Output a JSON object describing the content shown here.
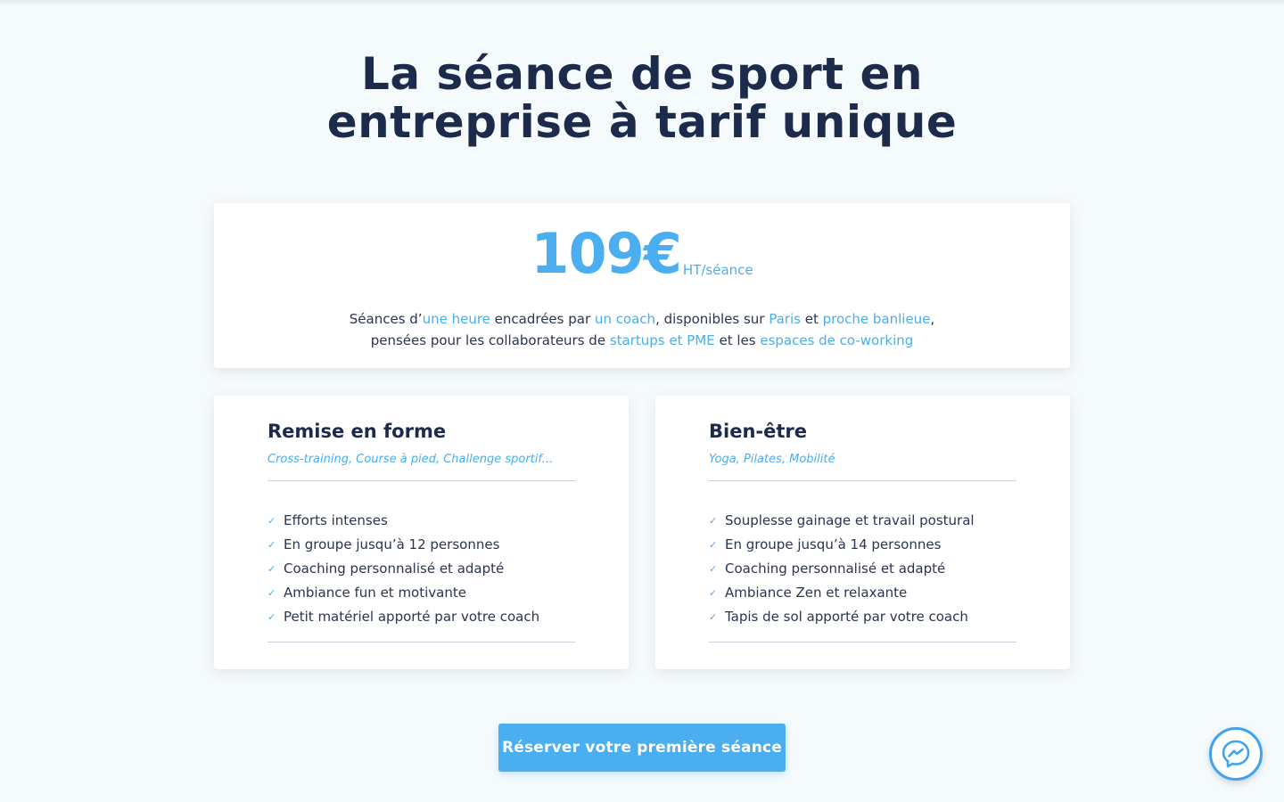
{
  "hero": {
    "title_line1": "La séance de sport en",
    "title_line2": "entreprise à tarif unique"
  },
  "pricing": {
    "amount": "109€",
    "unit": "HT/séance",
    "desc_line1": [
      {
        "text": "Séances d’",
        "hl": false
      },
      {
        "text": "une heure",
        "hl": true
      },
      {
        "text": " encadrées par ",
        "hl": false
      },
      {
        "text": "un coach",
        "hl": true
      },
      {
        "text": ", disponibles sur ",
        "hl": false
      },
      {
        "text": "Paris",
        "hl": true
      },
      {
        "text": " et ",
        "hl": false
      },
      {
        "text": "proche banlieue",
        "hl": true
      },
      {
        "text": ",",
        "hl": false
      }
    ],
    "desc_line2": [
      {
        "text": "pensées pour les collaborateurs de ",
        "hl": false
      },
      {
        "text": "startups et PME",
        "hl": true
      },
      {
        "text": " et les ",
        "hl": false
      },
      {
        "text": "espaces de co-working",
        "hl": true
      }
    ]
  },
  "offers": [
    {
      "title": "Remise en forme",
      "subtitle": "Cross-training, Course à pied, Challenge sportif...",
      "features": [
        "Efforts intenses",
        "En groupe jusqu’à 12 personnes",
        "Coaching personnalisé et adapté",
        "Ambiance fun et motivante",
        "Petit matériel apporté par votre coach"
      ]
    },
    {
      "title": "Bien-être",
      "subtitle": "Yoga, Pilates, Mobilité",
      "features": [
        "Souplesse gainage et travail postural",
        "En groupe jusqu’à 14 personnes",
        "Coaching personnalisé et adapté",
        "Ambiance Zen et relaxante",
        "Tapis de sol apporté par votre coach"
      ]
    }
  ],
  "cta": {
    "label": "Réserver votre première séance"
  },
  "icons": {
    "check": "check-icon",
    "messenger": "messenger-icon"
  },
  "colors": {
    "accent": "#4aaef0",
    "heading": "#1c2b4c",
    "background": "#f5fafd"
  }
}
